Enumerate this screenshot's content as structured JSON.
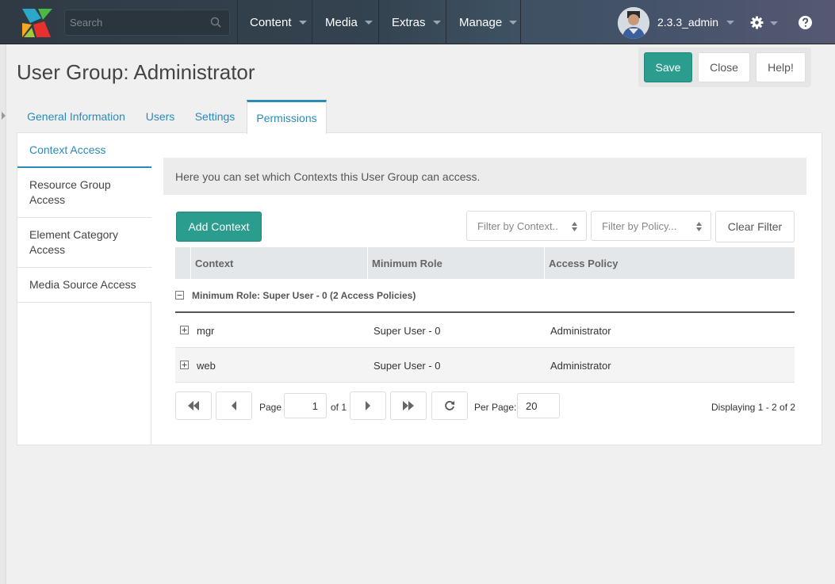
{
  "header": {
    "search_placeholder": "Search",
    "nav": [
      "Content",
      "Media",
      "Extras",
      "Manage"
    ],
    "username": "2.3.3_admin"
  },
  "page": {
    "title": "User Group: Administrator"
  },
  "actions": {
    "save": "Save",
    "close": "Close",
    "help": "Help!"
  },
  "tabs": [
    "General Information",
    "Users",
    "Settings",
    "Permissions"
  ],
  "active_tab": "Permissions",
  "side_tabs": [
    "Context Access",
    "Resource Group Access",
    "Element Category Access",
    "Media Source Access"
  ],
  "active_side_tab": "Context Access",
  "info_text": "Here you can set which Contexts this User Group can access.",
  "toolbar": {
    "add_context": "Add Context",
    "filter_context": "Filter by Context..",
    "filter_policy": "Filter by Policy...",
    "clear_filter": "Clear Filter"
  },
  "grid": {
    "columns": [
      "Context",
      "Minimum Role",
      "Access Policy"
    ],
    "group_label": "Minimum Role: Super User - 0 (2 Access Policies)",
    "rows": [
      {
        "context": "mgr",
        "role": "Super User - 0",
        "policy": "Administrator"
      },
      {
        "context": "web",
        "role": "Super User - 0",
        "policy": "Administrator"
      }
    ]
  },
  "pager": {
    "page_label": "Page",
    "page_value": "1",
    "of_label": "of 1",
    "per_page_label": "Per Page:",
    "per_page_value": "20",
    "display_text": "Displaying 1 - 2 of 2"
  },
  "colors": {
    "accent": "#2c8ab8",
    "primary_button": "#2a9d8f"
  },
  "icons": [
    "logo-icon",
    "search-icon",
    "gear-icon",
    "help-icon",
    "expand-icon",
    "collapse-icon",
    "first-page-icon",
    "prev-page-icon",
    "next-page-icon",
    "last-page-icon",
    "refresh-icon"
  ]
}
